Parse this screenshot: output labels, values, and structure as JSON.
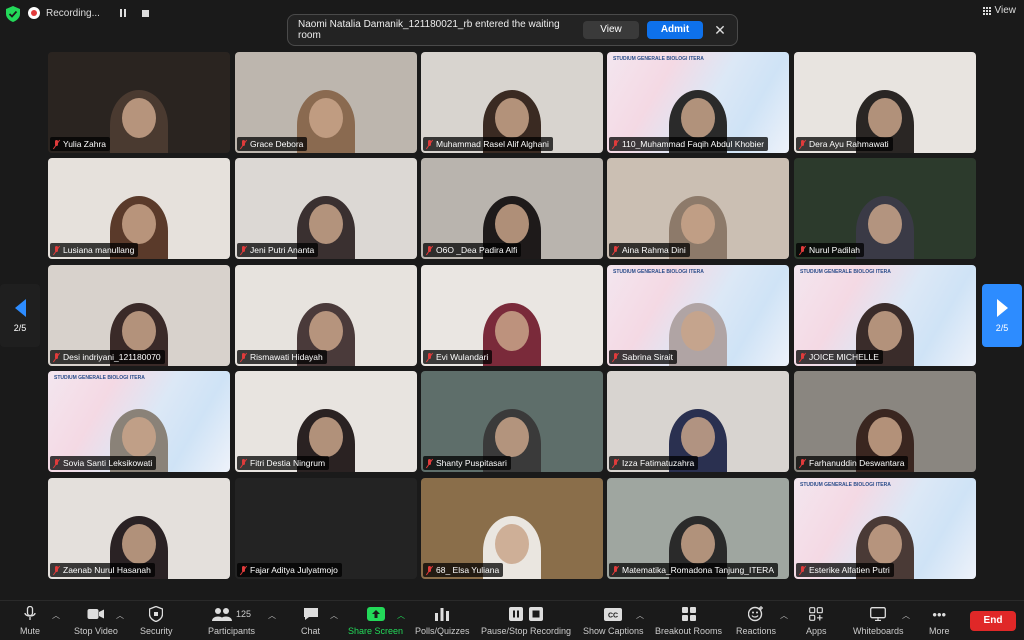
{
  "top_bar": {
    "recording_label": "Recording...",
    "view_label": "View"
  },
  "notification": {
    "text": "Naomi Natalia Damanik_121180021_rb entered the waiting room",
    "view_label": "View",
    "admit_label": "Admit"
  },
  "pagination": {
    "left_label": "2/5",
    "right_label": "2/5"
  },
  "participants": [
    {
      "name": "Yulia Zahra",
      "bg": "#2a2420",
      "cam": "#4a3a30"
    },
    {
      "name": "Grace Debora",
      "bg": "#bdb6ae",
      "cam": "#8a6a50"
    },
    {
      "name": "Muhammad Rasel Alif Alghani",
      "bg": "#d8d4cf",
      "cam": "#3a2a22"
    },
    {
      "name": "110_Muhammad Faqih Abdul Khobier",
      "bg": "slide",
      "cam": "#2a2a2a"
    },
    {
      "name": "Dera Ayu Rahmawati",
      "bg": "#e8e4e0",
      "cam": "#2a2624"
    },
    {
      "name": "Lusiana manullang",
      "bg": "#e6e1dc",
      "cam": "#5a3a2a"
    },
    {
      "name": "Jeni Putri Ananta",
      "bg": "#dcd8d4",
      "cam": "#3a3030"
    },
    {
      "name": "O6O _Dea Padira Alfi",
      "bg": "#b9b4ae",
      "cam": "#1e1a1a"
    },
    {
      "name": "Aina Rahma Dini",
      "bg": "#cbbfb3",
      "cam": "#8d7a6a"
    },
    {
      "name": "Nurul Padilah",
      "bg": "#2c3a2c",
      "cam": "#3a3a46"
    },
    {
      "name": "Desi indriyani_121180070",
      "bg": "#d8d2cc",
      "cam": "#3a2a28"
    },
    {
      "name": "Rismawati Hidayah",
      "bg": "#e7e3de",
      "cam": "#4a3a3a"
    },
    {
      "name": "Evi Wulandari",
      "bg": "#eae6e2",
      "cam": "#7a2a3a"
    },
    {
      "name": "Sabrina Sirait",
      "bg": "slide",
      "cam": "#b0a4a4"
    },
    {
      "name": "JOICE MICHELLE",
      "bg": "slide",
      "cam": "#3a2c2a"
    },
    {
      "name": "Sovia Santi Leksikowati",
      "bg": "slide",
      "cam": "#8a8278"
    },
    {
      "name": "Fitri Destia Ningrum",
      "bg": "#e8e4e0",
      "cam": "#2a2222"
    },
    {
      "name": "Shanty Puspitasari",
      "bg": "#5e6e6a",
      "cam": "#3a3a3a"
    },
    {
      "name": "Izza Fatimatuzahra",
      "bg": "#d8d4d0",
      "cam": "#2a3050"
    },
    {
      "name": "Farhanuddin Deswantara",
      "bg": "#8a8680",
      "cam": "#3a2620"
    },
    {
      "name": "Zaenab Nurul Hasanah",
      "bg": "#e4e0dc",
      "cam": "#2a2224"
    },
    {
      "name": "Fajar Aditya Julyatmojo",
      "bg": "none",
      "cam": "none"
    },
    {
      "name": "68_ Elsa Yuliana",
      "bg": "#8a6e4a",
      "cam": "#eae6e0"
    },
    {
      "name": "Matematika_Romadona Tanjung_ITERA",
      "bg": "#9fa6a0",
      "cam": "#2a2a2a"
    },
    {
      "name": "Esterike Alfatien Putri",
      "bg": "slide",
      "cam": "#4a3a36"
    }
  ],
  "slide_title": "STUDIUM GENERALE BIOLOGI ITERA",
  "toolbar": {
    "mute": "Mute",
    "stop_video": "Stop Video",
    "security": "Security",
    "participants": "Participants",
    "participants_count": "125",
    "chat": "Chat",
    "share_screen": "Share Screen",
    "polls": "Polls/Quizzes",
    "pause_recording": "Pause/Stop Recording",
    "captions": "Show Captions",
    "breakout": "Breakout Rooms",
    "reactions": "Reactions",
    "apps": "Apps",
    "whiteboards": "Whiteboards",
    "more": "More",
    "end": "End"
  },
  "colors": {
    "accent_blue": "#2d8cff",
    "admit_blue": "#0e71eb",
    "end_red": "#e02828",
    "share_green": "#23d959",
    "mute_red": "#e03b3b"
  }
}
